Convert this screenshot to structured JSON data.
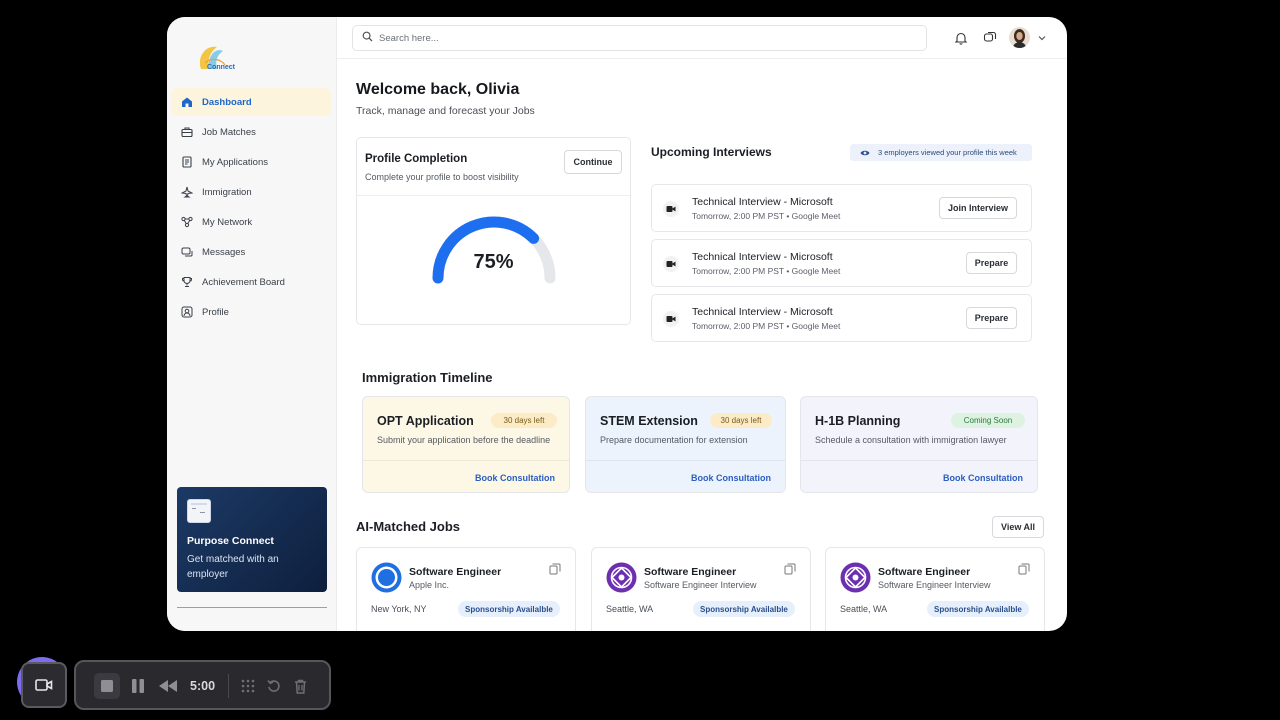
{
  "sidebar": {
    "logo_text": "Connect",
    "items": [
      {
        "label": "Dashboard",
        "icon": "home-icon"
      },
      {
        "label": "Job Matches",
        "icon": "briefcase-icon"
      },
      {
        "label": "My Applications",
        "icon": "document-icon"
      },
      {
        "label": "Immigration",
        "icon": "plane-icon"
      },
      {
        "label": "My Network",
        "icon": "network-icon"
      },
      {
        "label": "Messages",
        "icon": "chat-icon"
      },
      {
        "label": "Achievement Board",
        "icon": "trophy-icon"
      },
      {
        "label": "Profile",
        "icon": "user-icon"
      }
    ],
    "active_item": "Dashboard",
    "promo": {
      "title": "Purpose Connect",
      "subtitle": "Get matched with an employer"
    }
  },
  "header": {
    "search_placeholder": "Search here..."
  },
  "welcome": {
    "title": "Welcome back, Olivia",
    "subtitle": "Track, manage and forecast your Jobs"
  },
  "profile_completion": {
    "title": "Profile Completion",
    "subtitle": "Complete your profile to boost visibility",
    "button": "Continue",
    "percent_label": "75%",
    "progress": 0.75
  },
  "interviews": {
    "title": "Upcoming Interviews",
    "views_badge": "3 employers viewed your profile this week",
    "items": [
      {
        "title": "Technical Interview - Microsoft",
        "time": "Tomorrow, 2:00 PM PST • Google Meet",
        "action": "Join Interview"
      },
      {
        "title": "Technical Interview - Microsoft",
        "time": "Tomorrow, 2:00 PM PST • Google Meet",
        "action": "Prepare"
      },
      {
        "title": "Technical Interview - Microsoft",
        "time": "Tomorrow, 2:00 PM PST • Google Meet",
        "action": "Prepare"
      }
    ]
  },
  "immigration": {
    "title": "Immigration Timeline",
    "cards": [
      {
        "title": "OPT Application",
        "badge": "30 days left",
        "subtitle": "Submit your application before the deadline",
        "link": "Book Consultation",
        "bg": "#fdf7e6",
        "badge_bg": "#fbecc7",
        "badge_color": "#7a5a16"
      },
      {
        "title": "STEM Extension",
        "badge": "30 days left",
        "subtitle": "Prepare documentation for extension",
        "link": "Book Consultation",
        "bg": "#edf3fc",
        "badge_bg": "#fbecc7",
        "badge_color": "#7a5a16"
      },
      {
        "title": "H-1B Planning",
        "badge": "Coming Soon",
        "subtitle": "Schedule a consultation with immigration lawyer",
        "link": "Book Consultation",
        "bg": "#f2f3fb",
        "badge_bg": "#def2e1",
        "badge_color": "#2b7a3d"
      }
    ]
  },
  "ai_jobs": {
    "title": "AI-Matched Jobs",
    "view_all": "View All",
    "jobs": [
      {
        "title": "Software Engineer",
        "company": "Apple Inc.",
        "location": "New York, NY",
        "badge": "Sponsorship Availalble",
        "logo_color": "#1f6fe0"
      },
      {
        "title": "Software Engineer",
        "company": "Software Engineer Interview",
        "location": "Seattle, WA",
        "badge": "Sponsorship Availalble",
        "logo_color": "#6b2fb0"
      },
      {
        "title": "Software Engineer",
        "company": "Software Engineer Interview",
        "location": "Seattle, WA",
        "badge": "Sponsorship Availalble",
        "logo_color": "#6b2fb0"
      }
    ]
  },
  "recorder": {
    "time": "5:00"
  }
}
